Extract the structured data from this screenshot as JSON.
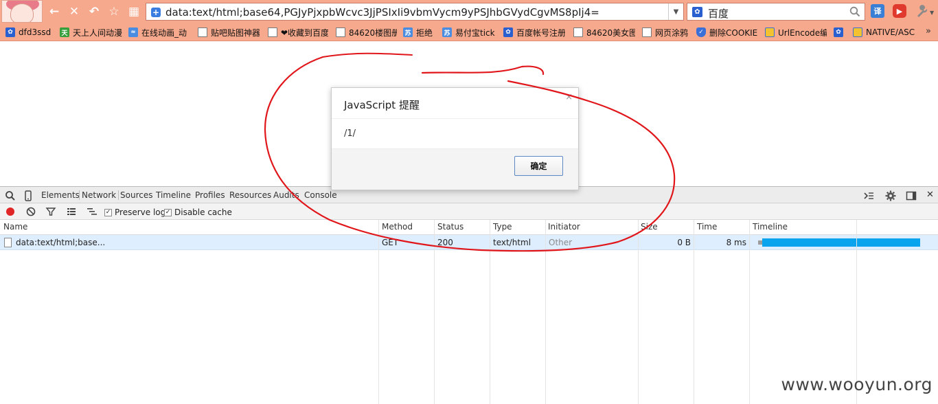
{
  "browser": {
    "address_url": "data:text/html;base64,PGJyPjxpbWcvc3JjPSIxIi9vbmVycm9yPSJhbGVydCgvMS8pIj4=",
    "search_query": "百度",
    "translate_label": "译"
  },
  "bookmarks": [
    {
      "label": "dfd3ssd",
      "icon": "baidu-paw-icon"
    },
    {
      "label": "天上人间动漫",
      "icon": "tian-icon"
    },
    {
      "label": "在线动画_动",
      "icon": "site-icon"
    },
    {
      "label": "贴吧贴图神器",
      "icon": "page-icon"
    },
    {
      "label": "❤收藏到百度",
      "icon": "page-icon"
    },
    {
      "label": "84620楼图册",
      "icon": "page-icon"
    },
    {
      "label": "拒绝",
      "icon": "su-icon"
    },
    {
      "label": "易付宝tick",
      "icon": "su-icon"
    },
    {
      "label": "百度帐号注册",
      "icon": "baidu-paw-icon"
    },
    {
      "label": "84620美女图",
      "icon": "page-icon"
    },
    {
      "label": "网页涂鸦",
      "icon": "page-icon"
    },
    {
      "label": "删除COOKIE",
      "icon": "shield-icon"
    },
    {
      "label": "UrlEncode编",
      "icon": "url-icon"
    },
    {
      "label": "",
      "icon": "baidu-paw-icon"
    },
    {
      "label": "NATIVE/ASC",
      "icon": "url-icon"
    }
  ],
  "dialog": {
    "title": "JavaScript 提醒",
    "message": "/1/",
    "ok_label": "确定",
    "close_glyph": "×"
  },
  "devtools": {
    "tabs": [
      "Elements",
      "Network",
      "Sources",
      "Timeline",
      "Profiles",
      "Resources",
      "Audits",
      "Console"
    ],
    "active_tab": "Network",
    "preserve_log_label": "Preserve log",
    "preserve_log_checked": true,
    "disable_cache_label": "Disable cache",
    "disable_cache_checked": true,
    "columns": [
      "Name",
      "Method",
      "Status",
      "Type",
      "Initiator",
      "Size",
      "Time",
      "Timeline"
    ],
    "rows": [
      {
        "name": "data:text/html;base...",
        "method": "GET",
        "status": "200",
        "type": "text/html",
        "initiator": "Other",
        "size": "0 B",
        "time": "8 ms"
      }
    ]
  },
  "colors": {
    "toolbar_bg": "#f6a98c",
    "timeline_bar": "#0aa3ee",
    "record_red": "#e02626",
    "annotation_red": "#e0161b",
    "selected_row": "#dfeefe"
  },
  "watermark": "www.wooyun.org"
}
